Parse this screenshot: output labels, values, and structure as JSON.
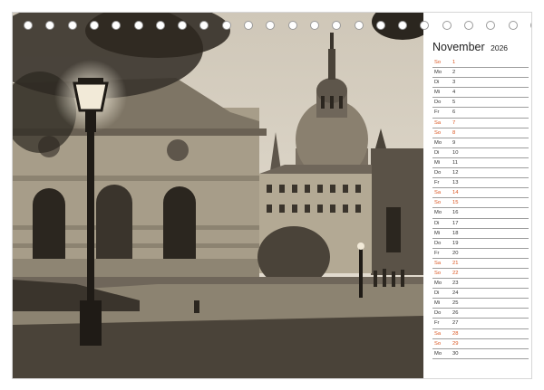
{
  "calendar": {
    "month": "November",
    "year": "2026",
    "weekend_color": "#d9531e",
    "days": [
      {
        "abbr": "So",
        "num": "1",
        "weekend": true
      },
      {
        "abbr": "Mo",
        "num": "2",
        "weekend": false
      },
      {
        "abbr": "Di",
        "num": "3",
        "weekend": false
      },
      {
        "abbr": "Mi",
        "num": "4",
        "weekend": false
      },
      {
        "abbr": "Do",
        "num": "5",
        "weekend": false
      },
      {
        "abbr": "Fr",
        "num": "6",
        "weekend": false
      },
      {
        "abbr": "Sa",
        "num": "7",
        "weekend": true
      },
      {
        "abbr": "So",
        "num": "8",
        "weekend": true
      },
      {
        "abbr": "Mo",
        "num": "9",
        "weekend": false
      },
      {
        "abbr": "Di",
        "num": "10",
        "weekend": false
      },
      {
        "abbr": "Mi",
        "num": "11",
        "weekend": false
      },
      {
        "abbr": "Do",
        "num": "12",
        "weekend": false
      },
      {
        "abbr": "Fr",
        "num": "13",
        "weekend": false
      },
      {
        "abbr": "Sa",
        "num": "14",
        "weekend": true
      },
      {
        "abbr": "So",
        "num": "15",
        "weekend": true
      },
      {
        "abbr": "Mo",
        "num": "16",
        "weekend": false
      },
      {
        "abbr": "Di",
        "num": "17",
        "weekend": false
      },
      {
        "abbr": "Mi",
        "num": "18",
        "weekend": false
      },
      {
        "abbr": "Do",
        "num": "19",
        "weekend": false
      },
      {
        "abbr": "Fr",
        "num": "20",
        "weekend": false
      },
      {
        "abbr": "Sa",
        "num": "21",
        "weekend": true
      },
      {
        "abbr": "So",
        "num": "22",
        "weekend": true
      },
      {
        "abbr": "Mo",
        "num": "23",
        "weekend": false
      },
      {
        "abbr": "Di",
        "num": "24",
        "weekend": false
      },
      {
        "abbr": "Mi",
        "num": "25",
        "weekend": false
      },
      {
        "abbr": "Do",
        "num": "26",
        "weekend": false
      },
      {
        "abbr": "Fr",
        "num": "27",
        "weekend": false
      },
      {
        "abbr": "Sa",
        "num": "28",
        "weekend": true
      },
      {
        "abbr": "So",
        "num": "29",
        "weekend": true
      },
      {
        "abbr": "Mo",
        "num": "30",
        "weekend": false
      }
    ]
  },
  "photo": {
    "icon": "sepia-city-photo",
    "tone_colors": [
      "#2b261f",
      "#6f665a",
      "#bdb3a2",
      "#e6e0d4"
    ]
  }
}
